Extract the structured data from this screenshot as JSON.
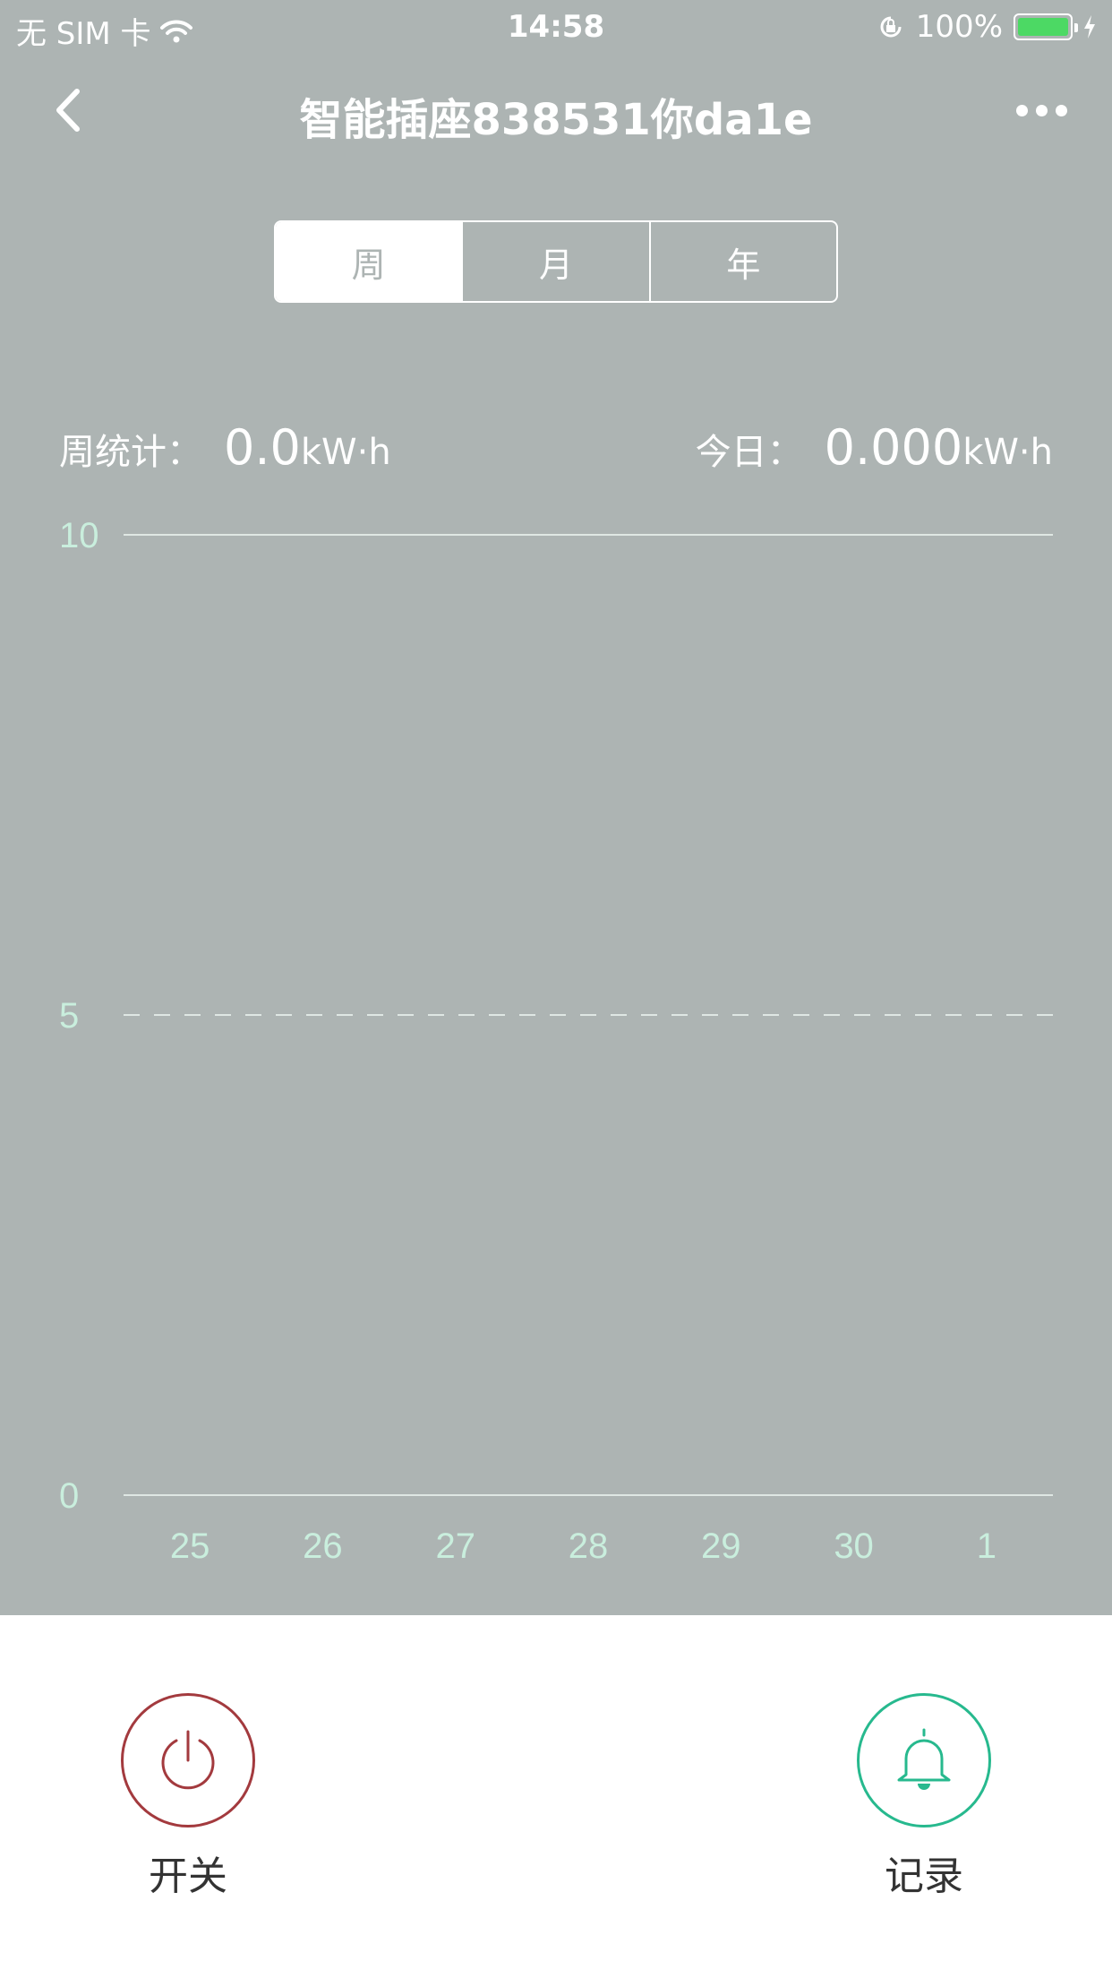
{
  "status_bar": {
    "carrier": "无 SIM 卡",
    "time": "14:58",
    "battery": "100%"
  },
  "nav": {
    "title": "智能插座838531你da1e"
  },
  "segments": [
    {
      "label": "周",
      "active": true
    },
    {
      "label": "月",
      "active": false
    },
    {
      "label": "年",
      "active": false
    }
  ],
  "stats": {
    "week_label": "周统计：",
    "week_value": "0.0",
    "week_unit": "kW·h",
    "today_label": "今日：",
    "today_value": "0.000",
    "today_unit": "kW·h"
  },
  "chart_data": {
    "type": "bar",
    "categories": [
      "25",
      "26",
      "27",
      "28",
      "29",
      "30",
      "1"
    ],
    "values": [
      0,
      0,
      0,
      0,
      0,
      0,
      0
    ],
    "ylim": [
      0,
      10
    ],
    "yticks": [
      "10",
      "5",
      "0"
    ],
    "colors": {
      "axis_text": "#c9eedd",
      "grid": "#dfe7e4"
    }
  },
  "actions": {
    "power_label": "开关",
    "record_label": "记录",
    "power_color": "#a33a3e",
    "record_color": "#27b98e"
  }
}
